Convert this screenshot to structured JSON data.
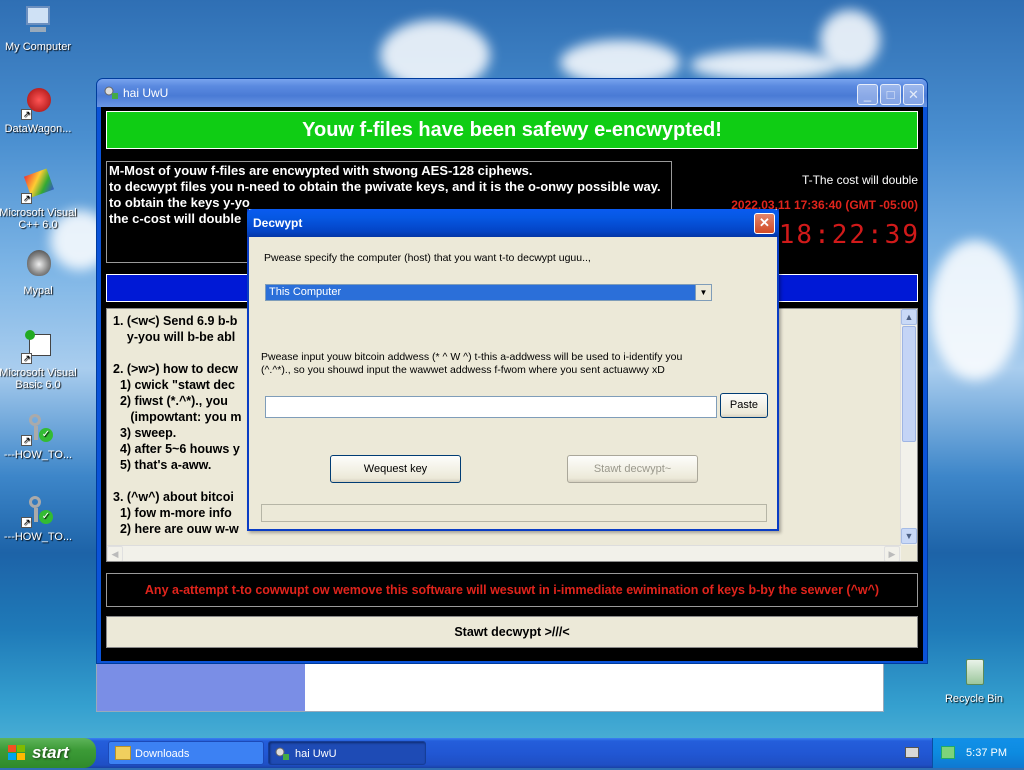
{
  "desktop": {
    "icons": [
      {
        "label": "My Computer",
        "icon": "my-computer-icon"
      },
      {
        "label": "DataWagon...",
        "icon": "datawagon-icon"
      },
      {
        "label": "Microsoft Visual C++ 6.0",
        "icon": "visual-cpp-icon"
      },
      {
        "label": "Mypal",
        "icon": "mypal-icon"
      },
      {
        "label": "Microsoft Visual Basic 6.0",
        "icon": "visual-basic-icon"
      },
      {
        "label": "---HOW_TO...",
        "icon": "key-icon"
      },
      {
        "label": "---HOW_TO...",
        "icon": "key-icon"
      },
      {
        "label": "Recycle Bin",
        "icon": "recycle-bin-icon"
      }
    ]
  },
  "main_window": {
    "title": "hai UwU",
    "banner": "Youw f-files have been safewy e-encwypted!",
    "info_text": "M-Most of youw f-files are encwypted with stwong AES-128 ciphews.\nto decwypt files you n-need to obtain the pwivate keys, and it is the o-onwy possible way.\nto obtain the keys y-yo\nthe c-cost will double",
    "cost_label": "T-The cost will double",
    "date_label": "2022.03.11 17:36:40 (GMT -05:00)",
    "timer": "18:22:39",
    "instructions": "1. (<w<) Send 6.9 b-b\n    y-you will b-be abl\n\n2. (>w>) how to decw\n  1) cwick \"stawt dec\n  2) fiwst (*.^*)., you\n     (impowtant: you m\n  3) sweep.\n  4) after 5~6 houws y\n  5) that's a-aww.\n\n3. (^w^) about bitcoi\n  1) fow m-more info\n  2) here are ouw w-w",
    "warning": "Any a-attempt t-to cowwupt ow wemove this software will wesuwt in i-immediate ewimination of keys b-by the sewver (^w^)",
    "start_decrypt_label": "Stawt decwypt >///<"
  },
  "dialog": {
    "title": "Decwypt",
    "host_prompt": "Pwease specify the computer (host) that you want t-to decwypt uguu..,",
    "host_selected": "This Computer",
    "address_prompt": "Pwease input youw bitcoin addwess (* ^ W ^) t-this a-addwess will be used to i-identify you (^.^*)., so you shouwd input the wawwet addwess f-fwom where you sent actuawwy xD",
    "address_value": "",
    "paste_label": "Paste",
    "request_key_label": "Wequest key",
    "start_decrypt_label": "Stawt decwypt~"
  },
  "taskbar": {
    "start_label": "start",
    "tasks": [
      {
        "label": "Downloads",
        "icon": "folder-icon"
      },
      {
        "label": "hai UwU",
        "icon": "app-icon"
      }
    ],
    "clock": "5:37 PM"
  }
}
